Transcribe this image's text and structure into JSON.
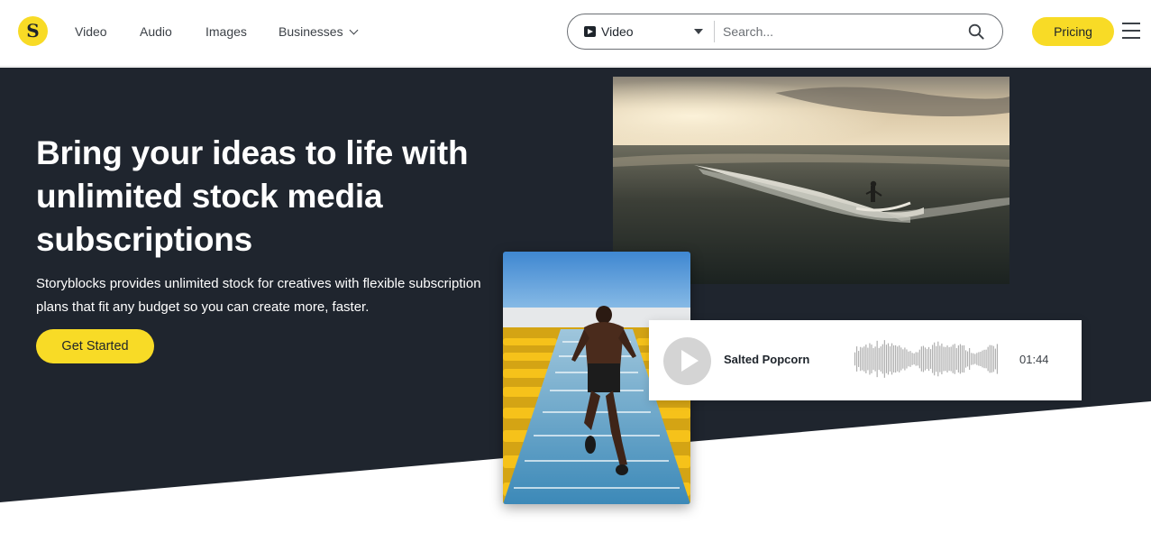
{
  "header": {
    "logo_letter": "S",
    "nav": {
      "video": "Video",
      "audio": "Audio",
      "images": "Images",
      "businesses": "Businesses"
    },
    "search": {
      "type_label": "Video",
      "placeholder": "Search..."
    },
    "pricing_label": "Pricing"
  },
  "hero": {
    "headline": "Bring your ideas to life with unlimited stock media subscriptions",
    "subtext": "Storyblocks provides unlimited stock for creatives with flexible subscription plans that fit any budget so you can create more, faster.",
    "cta_label": "Get Started"
  },
  "audio_card": {
    "title": "Salted Popcorn",
    "duration": "01:44"
  },
  "colors": {
    "brand_yellow": "#f8db26",
    "hero_dark": "#1f252e",
    "text_dark": "#1e242b"
  },
  "icons": {
    "logo": "storyblocks-logo-icon",
    "search": "magnifier-icon",
    "menu": "hamburger-menu-icon",
    "video_type": "play-square-icon",
    "play": "play-icon"
  }
}
